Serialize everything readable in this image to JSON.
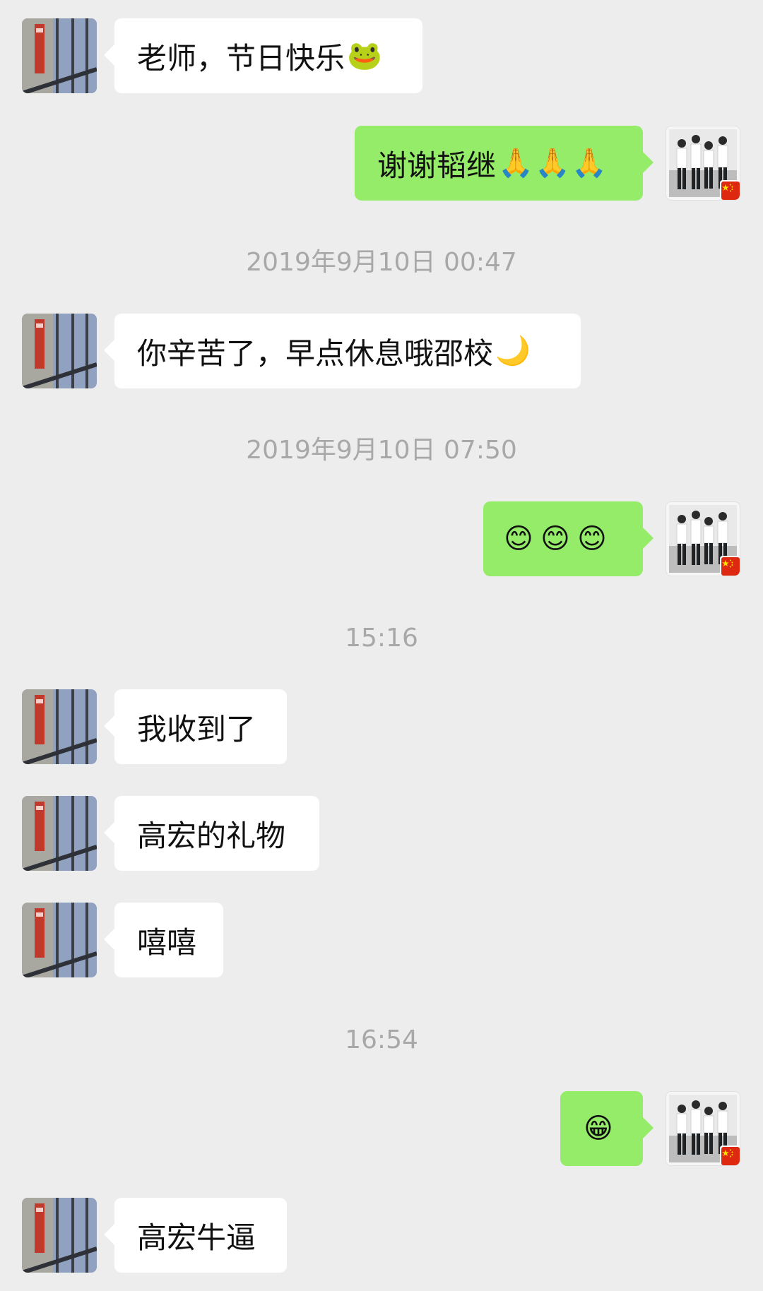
{
  "messages": [
    {
      "side": "left",
      "text": "老师，节日快乐",
      "emoji": [
        "🐸"
      ]
    },
    {
      "side": "right",
      "text": "谢谢韬继",
      "emoji": [
        "🙏",
        "🙏",
        "🙏"
      ]
    },
    {
      "timestamp": "2019年9月10日 00:47"
    },
    {
      "side": "left",
      "text": "你辛苦了，早点休息哦邵校",
      "emoji": [
        "🌙"
      ]
    },
    {
      "timestamp": "2019年9月10日 07:50"
    },
    {
      "side": "right",
      "text": "",
      "emoji": [
        "😊",
        "😊",
        "😊"
      ]
    },
    {
      "timestamp": "15:16"
    },
    {
      "side": "left",
      "text": "我收到了",
      "emoji": []
    },
    {
      "side": "left",
      "text": "高宏的礼物",
      "emoji": []
    },
    {
      "side": "left",
      "text": "嘻嘻",
      "emoji": []
    },
    {
      "timestamp": "16:54"
    },
    {
      "side": "right",
      "text": "",
      "emoji": [
        "😁"
      ]
    },
    {
      "side": "left",
      "text": "高宏牛逼",
      "emoji": []
    }
  ],
  "colors": {
    "background": "#ededed",
    "incoming_bubble": "#ffffff",
    "outgoing_bubble": "#95ec69",
    "timestamp_text": "#a8a8a8"
  },
  "icons": {
    "left_avatar": "building-photo-avatar",
    "right_avatar": "group-photo-avatar",
    "flag_badge": "china-flag-icon"
  }
}
